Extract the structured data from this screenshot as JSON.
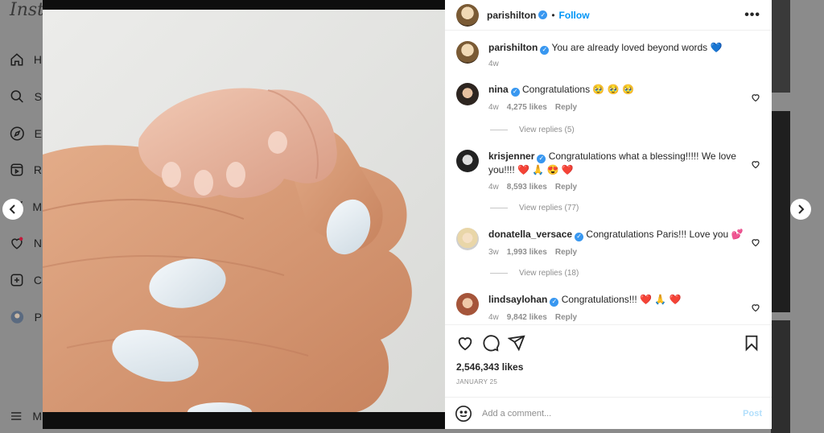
{
  "background": {
    "logo": "Insta",
    "nav": [
      {
        "label": "H",
        "icon": "home-icon"
      },
      {
        "label": "S",
        "icon": "search-icon"
      },
      {
        "label": "E",
        "icon": "explore-icon"
      },
      {
        "label": "R",
        "icon": "reels-icon"
      },
      {
        "label": "M",
        "icon": "messages-icon"
      },
      {
        "label": "N",
        "icon": "notifications-icon"
      },
      {
        "label": "C",
        "icon": "create-icon"
      },
      {
        "label": "P",
        "icon": "profile-icon"
      },
      {
        "label": "M",
        "icon": "menu-icon"
      }
    ]
  },
  "post": {
    "author": "parishilton",
    "follow_label": "Follow",
    "more_label": "•••",
    "caption": {
      "username": "parishilton",
      "text": "You are already loved beyond words 💙",
      "age": "4w"
    },
    "comments": [
      {
        "username": "nina",
        "text": "Congratulations 🥹 🥹 🥹",
        "age": "4w",
        "likes": "4,275 likes",
        "reply": "Reply",
        "view_replies": "View replies (5)"
      },
      {
        "username": "krisjenner",
        "text": "Congratulations what a blessing!!!!! We love you!!!! ❤️ 🙏 😍 ❤️",
        "age": "4w",
        "likes": "8,593 likes",
        "reply": "Reply",
        "view_replies": "View replies (77)"
      },
      {
        "username": "donatella_versace",
        "text": "Congratulations Paris!!! Love you 💕",
        "age": "3w",
        "likes": "1,993 likes",
        "reply": "Reply",
        "view_replies": "View replies (18)"
      },
      {
        "username": "lindsaylohan",
        "text": "Congratulations!!! ❤️ 🙏 ❤️",
        "age": "4w",
        "likes": "9,842 likes",
        "reply": "Reply"
      }
    ],
    "likes": "2,546,343 likes",
    "date": "JANUARY 25",
    "comment_placeholder": "Add a comment...",
    "post_label": "Post"
  },
  "colors": {
    "accent": "#0095f6",
    "verified": "#3897f0",
    "post_disabled": "#b2dffc",
    "nail": "#dfe8ee",
    "skin": "#d69a76"
  }
}
